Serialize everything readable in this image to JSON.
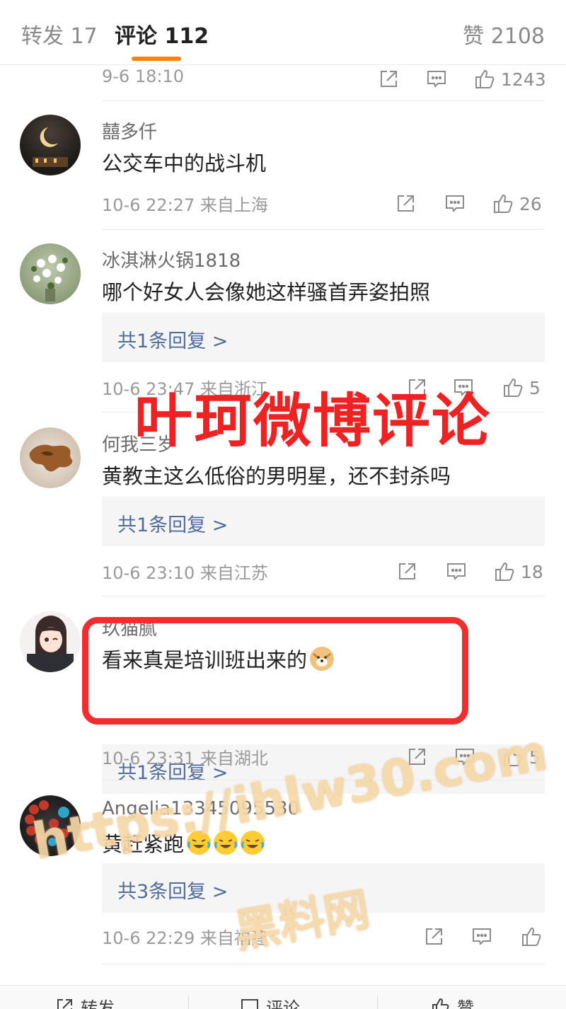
{
  "tabs": {
    "repost": "转发 17",
    "comments": "评论 112",
    "likes": "赞 2108"
  },
  "top_meta": {
    "time": "9-6 18:10",
    "like_count": "1243"
  },
  "comments": [
    {
      "username": "囍多仟",
      "text": "公交车中的战斗机",
      "meta": "10-6 22:27  来自上海",
      "like_count": "26",
      "reply": ""
    },
    {
      "username": "冰淇淋火锅1818",
      "text": "哪个好女人会像她这样骚首弄姿拍照",
      "meta": "10-6 23:47  来自浙江",
      "like_count": "5",
      "reply": "共1条回复 >"
    },
    {
      "username": "何我三岁",
      "text": "黄教主这么低俗的男明星，还不封杀吗",
      "meta": "10-6 23:10  来自江苏",
      "like_count": "18",
      "reply": "共1条回复 >"
    },
    {
      "username": "玖猫腻",
      "text": "看来真是培训班出来的",
      "meta": "10-6 23:31  来自湖北",
      "like_count": "5",
      "reply": "共1条回复 >"
    },
    {
      "username": "Angelia13345095530",
      "text": "黄赶紧跑",
      "meta": "10-6 22:29  来自福建",
      "like_count": "",
      "reply": "共3条回复 >"
    }
  ],
  "overlay": {
    "title": "叶珂微博评论",
    "watermark_url": "https://ihlw30.com",
    "watermark_name": "黑料网"
  },
  "bottom_bar": {
    "repost": "转发",
    "comment": "评论",
    "like": "赞"
  },
  "colors": {
    "accent": "#ff8200",
    "reply_link": "#506c9c",
    "overlay_red": "#ee2222",
    "watermark": "#f6d8a8"
  }
}
